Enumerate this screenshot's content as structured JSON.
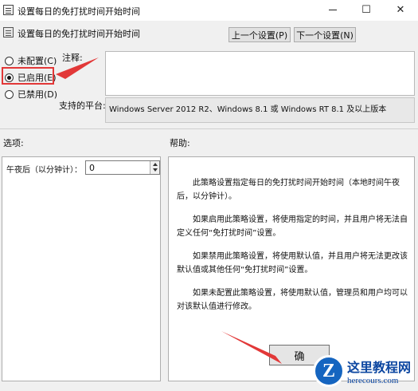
{
  "window": {
    "title": "设置每日的免打扰时间开始时间",
    "maximize_glyph": "☐",
    "close_glyph": "✕"
  },
  "header": {
    "policy_title": "设置每日的免打扰时间开始时间",
    "prev_button": "上一个设置(P)",
    "next_button": "下一个设置(N)"
  },
  "state": {
    "options": [
      {
        "label": "未配置(C)",
        "selected": false
      },
      {
        "label": "已启用(E)",
        "selected": true
      },
      {
        "label": "已禁用(D)",
        "selected": false
      }
    ]
  },
  "comment": {
    "label": "注释:",
    "value": ""
  },
  "platform": {
    "label": "支持的平台:",
    "value": "Windows Server 2012 R2、Windows 8.1 或 Windows RT 8.1 及以上版本"
  },
  "options_section": {
    "label": "选项:",
    "field_label": "午夜后（以分钟计）：",
    "field_value": "0"
  },
  "help_section": {
    "label": "帮助:",
    "paragraphs": [
      "此策略设置指定每日的免打扰时间开始时间（本地时间午夜后，以分钟计）。",
      "如果启用此策略设置，将使用指定的时间，并且用户将无法自定义任何“免打扰时间”设置。",
      "如果禁用此策略设置，将使用默认值，并且用户将无法更改该默认值或其他任何“免打扰时间”设置。",
      "如果未配置此策略设置，将使用默认值，管理员和用户均可以对该默认值进行修改。"
    ]
  },
  "footer": {
    "ok_partial": "确"
  },
  "colors": {
    "annotation_red": "#e23838",
    "watermark_blue": "#1565c0"
  },
  "watermark": {
    "letter": "Z",
    "title": "这里教程网",
    "url": "herecours.com"
  }
}
